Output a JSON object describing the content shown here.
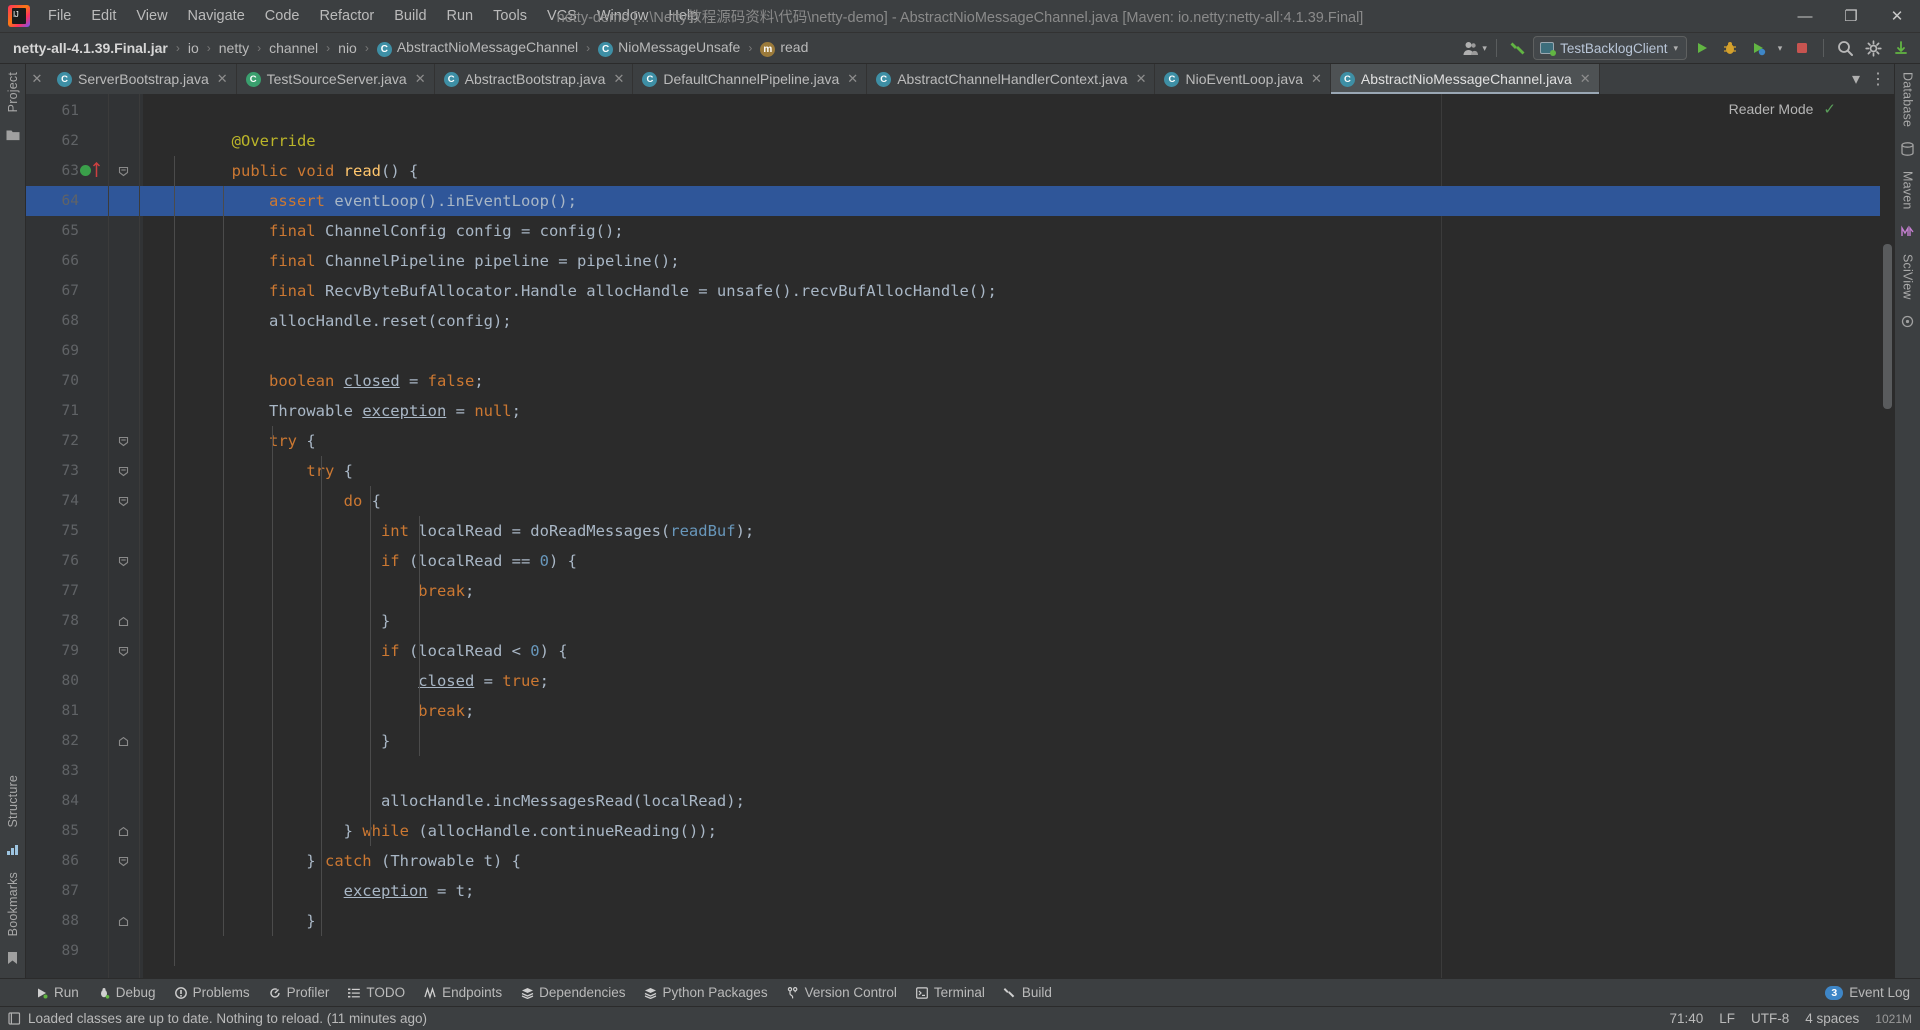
{
  "window": {
    "title": "netty-demo [...\\Netty教程源码资料\\代码\\netty-demo] - AbstractNioMessageChannel.java [Maven: io.netty:netty-all:4.1.39.Final]",
    "minimize_label": "—",
    "maximize_label": "❐",
    "close_label": "✕",
    "logo_name": "intellij-idea-logo"
  },
  "menubar": {
    "items": [
      {
        "label": "File"
      },
      {
        "label": "Edit"
      },
      {
        "label": "View"
      },
      {
        "label": "Navigate"
      },
      {
        "label": "Code"
      },
      {
        "label": "Refactor"
      },
      {
        "label": "Build"
      },
      {
        "label": "Run"
      },
      {
        "label": "Tools"
      },
      {
        "label": "VCS"
      },
      {
        "label": "Window"
      },
      {
        "label": "Help"
      }
    ]
  },
  "breadcrumb": {
    "items": [
      {
        "label": "netty-all-4.1.39.Final.jar",
        "icon": "",
        "bold": true
      },
      {
        "label": "io",
        "icon": ""
      },
      {
        "label": "netty",
        "icon": ""
      },
      {
        "label": "channel",
        "icon": ""
      },
      {
        "label": "nio",
        "icon": ""
      },
      {
        "label": "AbstractNioMessageChannel",
        "icon": "C"
      },
      {
        "label": "NioMessageUnsafe",
        "icon": "C"
      },
      {
        "label": "read",
        "icon": "m"
      }
    ],
    "separator": "›"
  },
  "toolbar": {
    "account_icon": "user-account-icon",
    "account_caret": "▾",
    "build_icon": "build-hammer-icon",
    "run_config": {
      "label": "TestBacklogClient",
      "caret": "▾",
      "icon": "application-config-icon"
    },
    "buttons": [
      {
        "name": "run-button",
        "glyph": "▶"
      },
      {
        "name": "debug-button",
        "glyph": "🐞"
      },
      {
        "name": "run-with-coverage-button",
        "glyph": "▶"
      },
      {
        "name": "more-run-options-button",
        "glyph": "▾"
      },
      {
        "name": "stop-button",
        "glyph": "■"
      },
      {
        "name": "search-everywhere-button",
        "glyph": "🔍"
      },
      {
        "name": "settings-button",
        "glyph": "⚙"
      },
      {
        "name": "update-project-button",
        "glyph": "▶"
      }
    ]
  },
  "tabs": {
    "items": [
      {
        "label": "ServerBootstrap.java",
        "icon": "C",
        "icon_color": "blue",
        "active": false
      },
      {
        "label": "TestSourceServer.java",
        "icon": "C",
        "icon_color": "green",
        "active": false
      },
      {
        "label": "AbstractBootstrap.java",
        "icon": "C",
        "icon_color": "blue",
        "active": false
      },
      {
        "label": "DefaultChannelPipeline.java",
        "icon": "C",
        "icon_color": "blue",
        "active": false
      },
      {
        "label": "AbstractChannelHandlerContext.java",
        "icon": "C",
        "icon_color": "blue",
        "active": false
      },
      {
        "label": "NioEventLoop.java",
        "icon": "C",
        "icon_color": "blue",
        "active": false
      },
      {
        "label": "AbstractNioMessageChannel.java",
        "icon": "C",
        "icon_color": "blue",
        "active": true
      }
    ],
    "close_glyph": "✕",
    "overflow_glyph": "▾",
    "options_glyph": "⋮"
  },
  "editor": {
    "reader_mode_label": "Reader Mode",
    "reader_mode_check": "✓",
    "first_line_number": 61,
    "highlighted_line": 64,
    "breakpoint_line": 63,
    "lines": [
      {
        "n": 61,
        "tokens": []
      },
      {
        "n": 62,
        "tokens": [
          {
            "t": "        ",
            "c": "id"
          },
          {
            "t": "@Override",
            "c": "ann"
          }
        ]
      },
      {
        "n": 63,
        "tokens": [
          {
            "t": "        ",
            "c": "id"
          },
          {
            "t": "public",
            "c": "kw"
          },
          {
            "t": " ",
            "c": "id"
          },
          {
            "t": "void",
            "c": "kw"
          },
          {
            "t": " ",
            "c": "id"
          },
          {
            "t": "read",
            "c": "fnd"
          },
          {
            "t": "() {",
            "c": "id"
          }
        ],
        "fold": true
      },
      {
        "n": 64,
        "tokens": [
          {
            "t": "            ",
            "c": "id"
          },
          {
            "t": "assert",
            "c": "kw"
          },
          {
            "t": " eventLoop().inEventLoop();",
            "c": "id"
          }
        ]
      },
      {
        "n": 65,
        "tokens": [
          {
            "t": "            ",
            "c": "id"
          },
          {
            "t": "final",
            "c": "kw"
          },
          {
            "t": " ChannelConfig config = config();",
            "c": "id"
          }
        ]
      },
      {
        "n": 66,
        "tokens": [
          {
            "t": "            ",
            "c": "id"
          },
          {
            "t": "final",
            "c": "kw"
          },
          {
            "t": " ChannelPipeline pipeline = pipeline();",
            "c": "id"
          }
        ]
      },
      {
        "n": 67,
        "tokens": [
          {
            "t": "            ",
            "c": "id"
          },
          {
            "t": "final",
            "c": "kw"
          },
          {
            "t": " RecvByteBufAllocator.Handle allocHandle = unsafe().recvBufAllocHandle();",
            "c": "id"
          }
        ]
      },
      {
        "n": 68,
        "tokens": [
          {
            "t": "            allocHandle.reset(config);",
            "c": "id"
          }
        ]
      },
      {
        "n": 69,
        "tokens": []
      },
      {
        "n": 70,
        "tokens": [
          {
            "t": "            ",
            "c": "id"
          },
          {
            "t": "boolean",
            "c": "kw"
          },
          {
            "t": " ",
            "c": "id"
          },
          {
            "t": "closed",
            "c": "fieldu"
          },
          {
            "t": " = ",
            "c": "id"
          },
          {
            "t": "false",
            "c": "kw"
          },
          {
            "t": ";",
            "c": "id"
          }
        ]
      },
      {
        "n": 71,
        "tokens": [
          {
            "t": "            Throwable ",
            "c": "id"
          },
          {
            "t": "exception",
            "c": "fieldu"
          },
          {
            "t": " = ",
            "c": "id"
          },
          {
            "t": "null",
            "c": "kw"
          },
          {
            "t": ";",
            "c": "id"
          }
        ]
      },
      {
        "n": 72,
        "tokens": [
          {
            "t": "            ",
            "c": "id"
          },
          {
            "t": "try",
            "c": "kw"
          },
          {
            "t": " {",
            "c": "id"
          }
        ],
        "fold": true
      },
      {
        "n": 73,
        "tokens": [
          {
            "t": "                ",
            "c": "id"
          },
          {
            "t": "try",
            "c": "kw"
          },
          {
            "t": " {",
            "c": "id"
          }
        ],
        "fold": true
      },
      {
        "n": 74,
        "tokens": [
          {
            "t": "                    ",
            "c": "id"
          },
          {
            "t": "do",
            "c": "kw"
          },
          {
            "t": " {",
            "c": "id"
          }
        ],
        "fold": true
      },
      {
        "n": 75,
        "tokens": [
          {
            "t": "                        ",
            "c": "id"
          },
          {
            "t": "int",
            "c": "kw"
          },
          {
            "t": " localRead = doReadMessages(",
            "c": "id"
          },
          {
            "t": "readBuf",
            "c": "num"
          },
          {
            "t": ");",
            "c": "id"
          }
        ]
      },
      {
        "n": 76,
        "tokens": [
          {
            "t": "                        ",
            "c": "id"
          },
          {
            "t": "if",
            "c": "kw"
          },
          {
            "t": " (localRead == ",
            "c": "id"
          },
          {
            "t": "0",
            "c": "num"
          },
          {
            "t": ") {",
            "c": "id"
          }
        ],
        "fold": true
      },
      {
        "n": 77,
        "tokens": [
          {
            "t": "                            ",
            "c": "id"
          },
          {
            "t": "break",
            "c": "kw"
          },
          {
            "t": ";",
            "c": "id"
          }
        ]
      },
      {
        "n": 78,
        "tokens": [
          {
            "t": "                        }",
            "c": "id"
          }
        ],
        "foldend": true
      },
      {
        "n": 79,
        "tokens": [
          {
            "t": "                        ",
            "c": "id"
          },
          {
            "t": "if",
            "c": "kw"
          },
          {
            "t": " (localRead < ",
            "c": "id"
          },
          {
            "t": "0",
            "c": "num"
          },
          {
            "t": ") {",
            "c": "id"
          }
        ],
        "fold": true
      },
      {
        "n": 80,
        "tokens": [
          {
            "t": "                            ",
            "c": "id"
          },
          {
            "t": "closed",
            "c": "fieldu"
          },
          {
            "t": " = ",
            "c": "id"
          },
          {
            "t": "true",
            "c": "kw"
          },
          {
            "t": ";",
            "c": "id"
          }
        ]
      },
      {
        "n": 81,
        "tokens": [
          {
            "t": "                            ",
            "c": "id"
          },
          {
            "t": "break",
            "c": "kw"
          },
          {
            "t": ";",
            "c": "id"
          }
        ]
      },
      {
        "n": 82,
        "tokens": [
          {
            "t": "                        }",
            "c": "id"
          }
        ],
        "foldend": true
      },
      {
        "n": 83,
        "tokens": []
      },
      {
        "n": 84,
        "tokens": [
          {
            "t": "                        allocHandle.incMessagesRead(localRead);",
            "c": "id"
          }
        ]
      },
      {
        "n": 85,
        "tokens": [
          {
            "t": "                    } ",
            "c": "id"
          },
          {
            "t": "while",
            "c": "kw"
          },
          {
            "t": " (allocHandle.continueReading());",
            "c": "id"
          }
        ],
        "foldend": true
      },
      {
        "n": 86,
        "tokens": [
          {
            "t": "                } ",
            "c": "id"
          },
          {
            "t": "catch",
            "c": "kw"
          },
          {
            "t": " (Throwable t) {",
            "c": "id"
          }
        ],
        "fold": true
      },
      {
        "n": 87,
        "tokens": [
          {
            "t": "                    ",
            "c": "id"
          },
          {
            "t": "exception",
            "c": "fieldu"
          },
          {
            "t": " = t;",
            "c": "id"
          }
        ]
      },
      {
        "n": 88,
        "tokens": [
          {
            "t": "                }",
            "c": "id"
          }
        ],
        "foldend": true
      },
      {
        "n": 89,
        "tokens": []
      }
    ]
  },
  "left_stripe": {
    "project_label": "Project",
    "structure_label": "Structure",
    "bookmarks_label": "Bookmarks"
  },
  "right_stripe": {
    "database_label": "Database",
    "maven_label": "Maven",
    "scivew_label": "SciView"
  },
  "tool_strip": {
    "items": [
      {
        "label": "Run",
        "icon": "run-icon"
      },
      {
        "label": "Debug",
        "icon": "debug-icon"
      },
      {
        "label": "Problems",
        "icon": "problems-icon"
      },
      {
        "label": "Profiler",
        "icon": "profiler-icon"
      },
      {
        "label": "TODO",
        "icon": "todo-icon"
      },
      {
        "label": "Endpoints",
        "icon": "endpoints-icon"
      },
      {
        "label": "Dependencies",
        "icon": "dependencies-icon"
      },
      {
        "label": "Python Packages",
        "icon": "python-packages-icon"
      },
      {
        "label": "Version Control",
        "icon": "version-control-icon"
      },
      {
        "label": "Terminal",
        "icon": "terminal-icon"
      },
      {
        "label": "Build",
        "icon": "build-icon"
      }
    ],
    "event_log": {
      "label": "Event Log",
      "count": "3"
    }
  },
  "statusbar": {
    "message": "Loaded classes are up to date. Nothing to reload. (11 minutes ago)",
    "message_icon": "book-icon",
    "caret_position": "71:40",
    "line_separator": "LF",
    "encoding": "UTF-8",
    "indent": "4 spaces",
    "memory": "1021M"
  }
}
